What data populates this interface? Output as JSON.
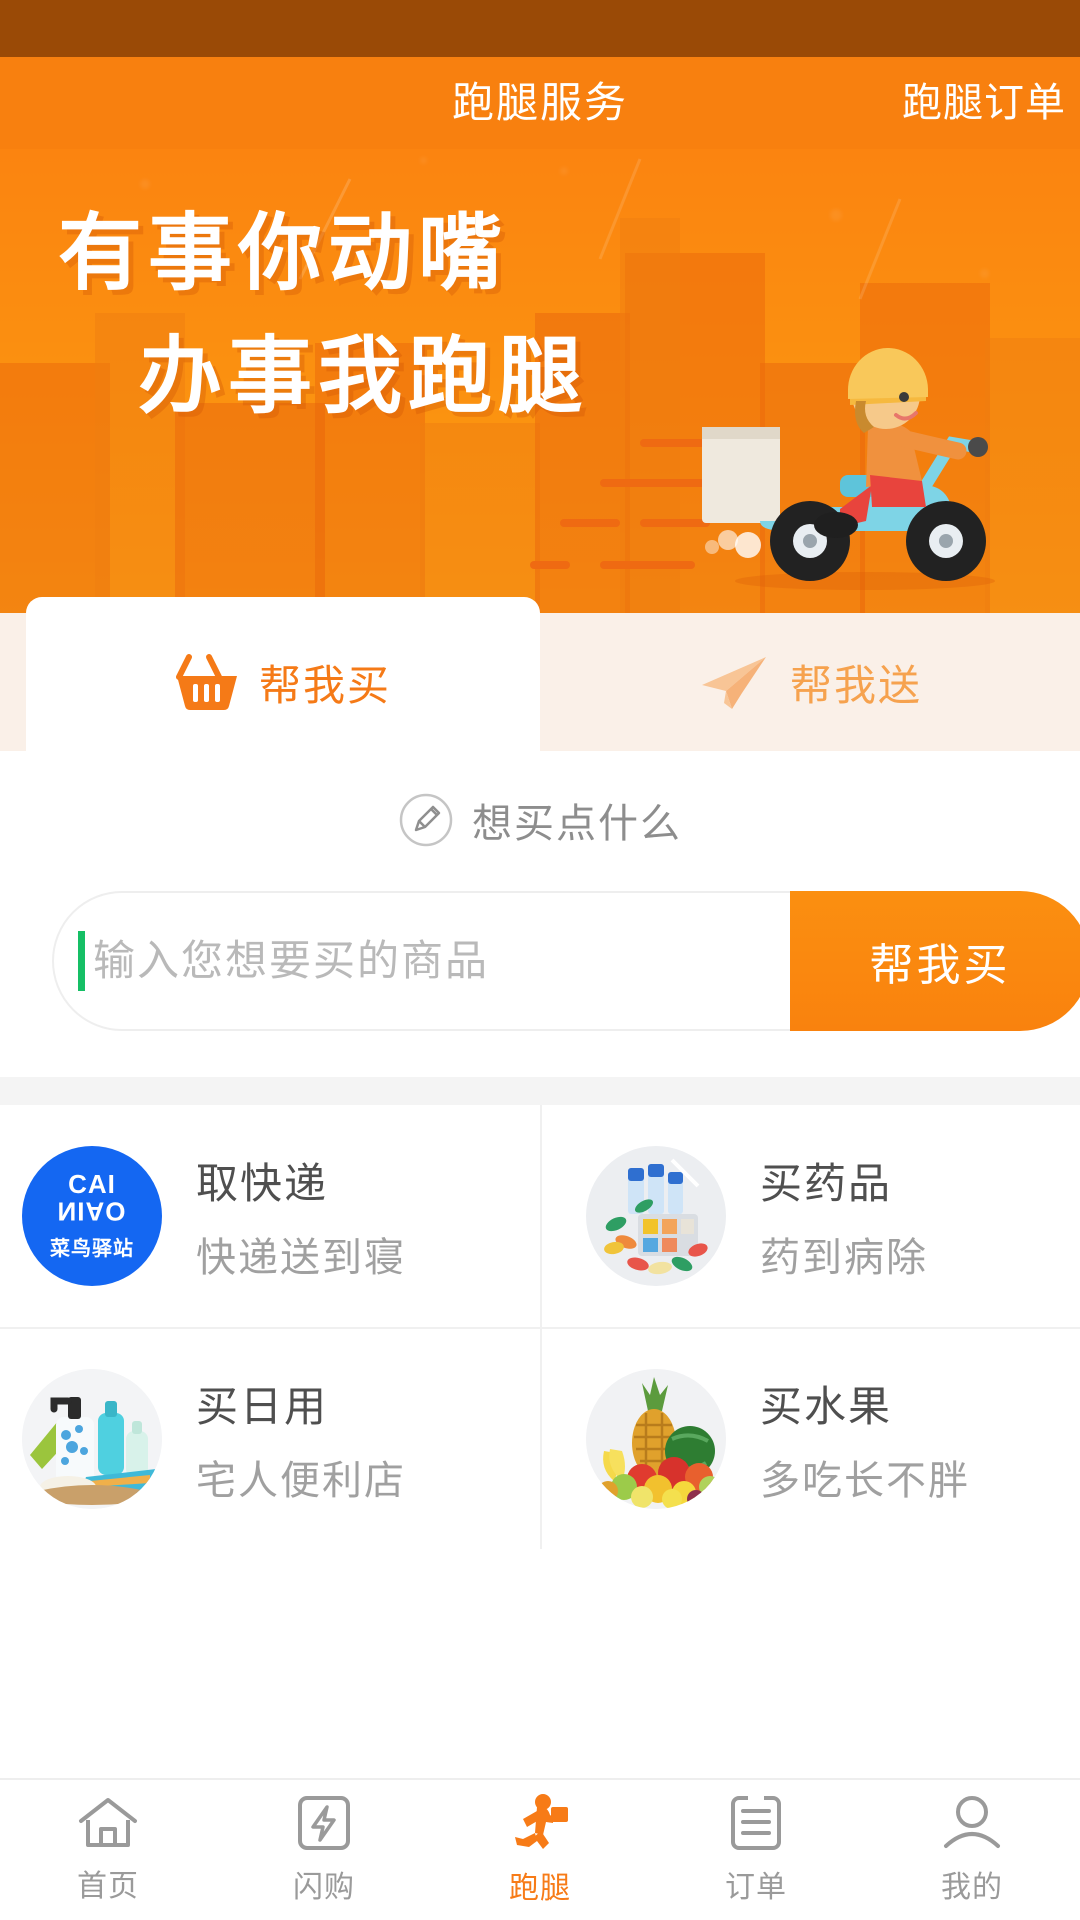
{
  "theme": {
    "statusbar_color": "#9a4a06",
    "header_color": "#f8800f",
    "accent_color": "#f77b17",
    "accent_color_light": "#f6a24e",
    "tab_inactive_bg": "#faf0e8",
    "caret_color": "#15bf65",
    "cainiao_blue": "#1467f2",
    "separator_color": "#f4f4f4"
  },
  "header": {
    "title": "跑腿服务",
    "action_label": "跑腿订单"
  },
  "banner": {
    "line1": "有事你动嘴",
    "line2": "办事我跑腿",
    "illustration_name": "scooter-courier-illustration"
  },
  "tabs": [
    {
      "label": "帮我买",
      "icon": "shopping-basket-icon",
      "active": true
    },
    {
      "label": "帮我送",
      "icon": "paper-plane-icon",
      "active": false
    }
  ],
  "buy_panel": {
    "prompt_icon": "pencil-circle-icon",
    "prompt_text": "想买点什么",
    "input_value": "",
    "input_placeholder": "输入您想要买的商品",
    "submit_label": "帮我买"
  },
  "services": [
    {
      "title": "取快递",
      "subtitle": "快递送到寝",
      "icon": "cainiao-logo-icon",
      "logo_line1": "CAI",
      "logo_line2": "NIAO",
      "logo_line3": "菜鸟驿站"
    },
    {
      "title": "买药品",
      "subtitle": "药到病除",
      "icon": "medicine-photo"
    },
    {
      "title": "买日用",
      "subtitle": "宅人便利店",
      "icon": "toiletries-photo"
    },
    {
      "title": "买水果",
      "subtitle": "多吃长不胖",
      "icon": "fruits-photo"
    }
  ],
  "bottom_nav": [
    {
      "label": "首页",
      "icon": "home-icon",
      "active": false
    },
    {
      "label": "闪购",
      "icon": "flash-sale-icon",
      "active": false
    },
    {
      "label": "跑腿",
      "icon": "running-courier-icon",
      "active": true
    },
    {
      "label": "订单",
      "icon": "order-list-icon",
      "active": false
    },
    {
      "label": "我的",
      "icon": "user-profile-icon",
      "active": false
    }
  ]
}
